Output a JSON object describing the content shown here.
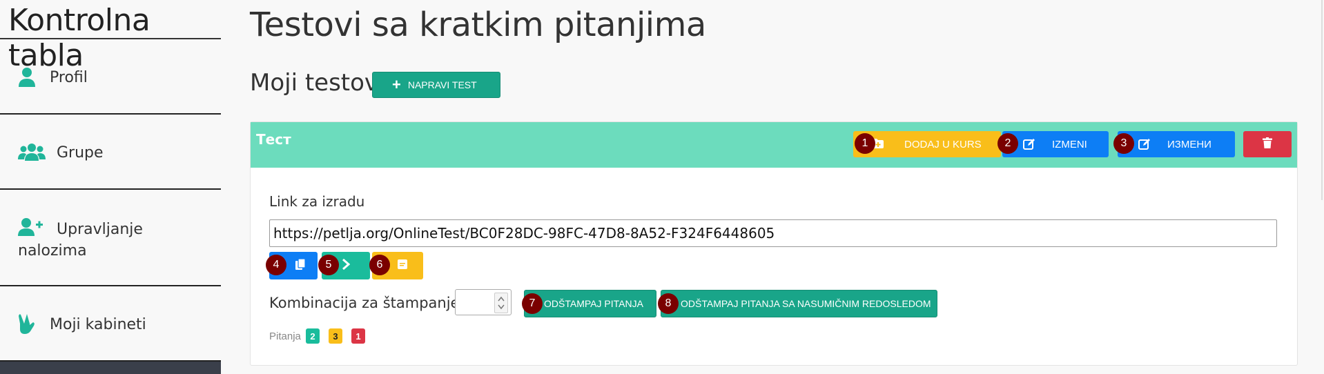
{
  "sidebar": {
    "title": "Kontrolna tabla",
    "items": [
      {
        "label": "Profil",
        "icon": "user-icon"
      },
      {
        "label": "Grupe",
        "icon": "users-icon"
      },
      {
        "label": "Upravljanje nalozima",
        "icon": "user-plus-icon"
      },
      {
        "label": "Moji kabineti",
        "icon": "hand-peace-icon"
      }
    ]
  },
  "page": {
    "title": "Testovi sa kratkim pitanjima",
    "subtitle": "Moji testovi",
    "create_button": "NAPRAVI TEST"
  },
  "card": {
    "title": "Тест",
    "buttons": {
      "add_to_course": "DODAJ U KURS",
      "edit_latin": "IZMENI",
      "edit_cyrillic": "ИЗМЕНИ"
    },
    "link_label": "Link za izradu",
    "link_value": "https://petlja.org/OnlineTest/BC0F28DC-98FC-47D8-8A52-F324F6448605",
    "combination_label": "Kombinacija za štampanje",
    "combination_value": "",
    "print_button": "ODŠTAMPAJ PITANJA",
    "print_random_button": "ODŠTAMPAJ PITANJA SA NASUMIČNIM REDOSLEDOM",
    "questions_label": "Pitanja",
    "question_counts": [
      "2",
      "3",
      "1"
    ]
  },
  "markers": [
    "1",
    "2",
    "3",
    "4",
    "5",
    "6",
    "7",
    "8"
  ],
  "colors": {
    "accent": "#1abc9c",
    "card_header": "#6cdcbd",
    "blue": "#0d7ef5",
    "yellow": "#f9be1a",
    "red": "#dc3545",
    "marker": "#7a0000"
  }
}
